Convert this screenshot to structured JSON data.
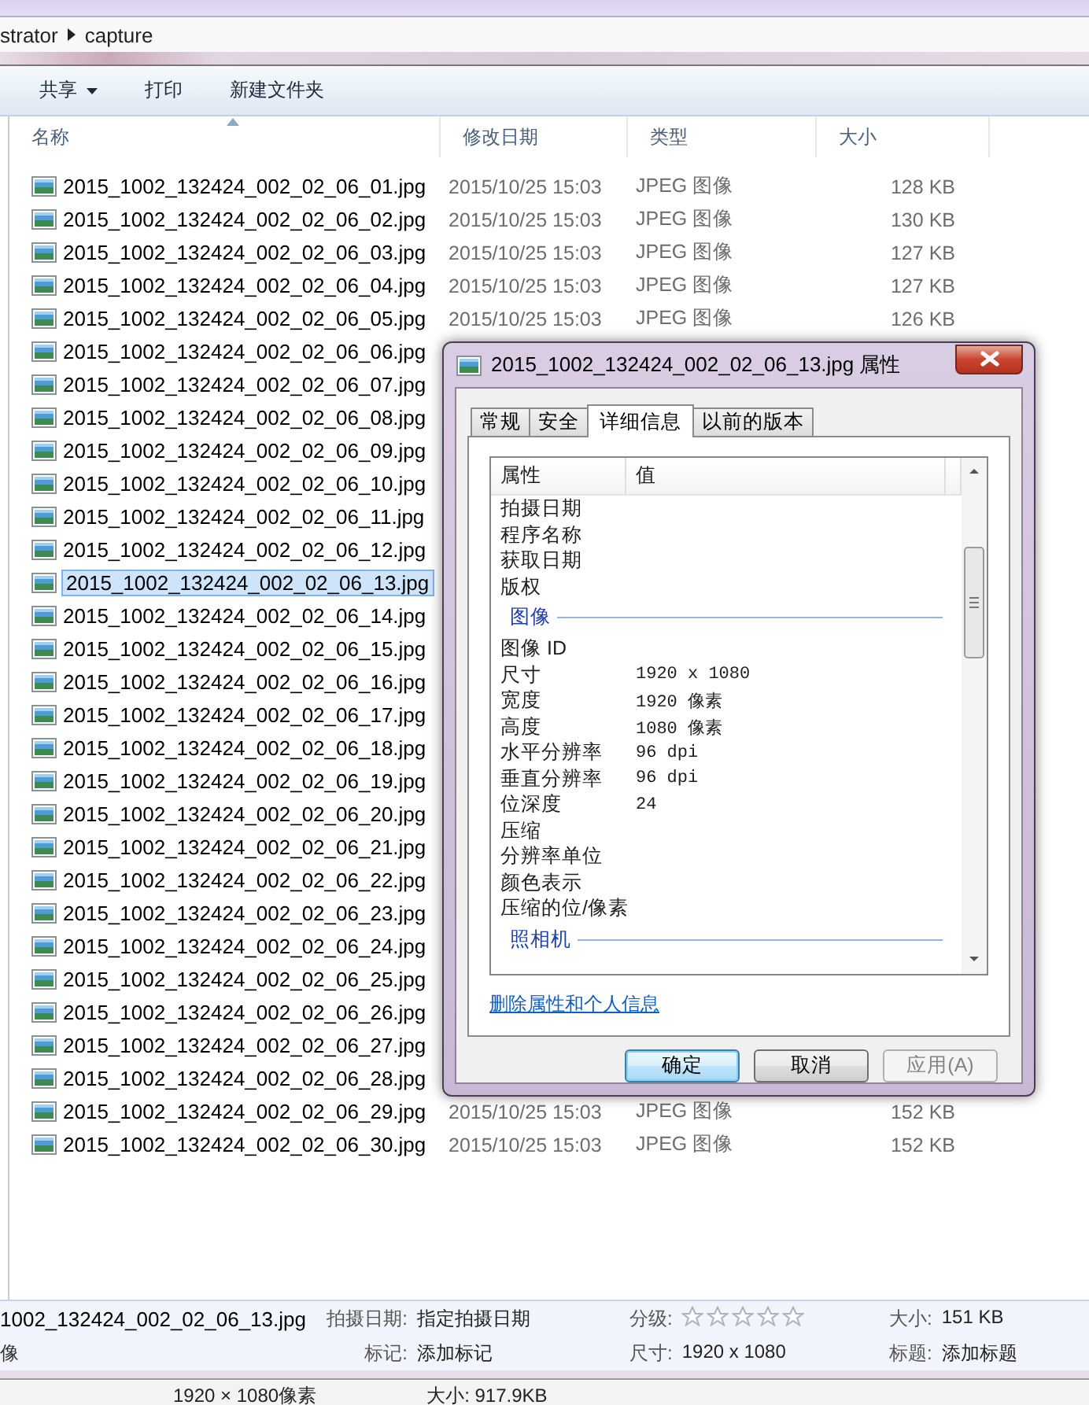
{
  "breadcrumb": {
    "items": [
      "strator",
      "capture"
    ]
  },
  "toolbar": {
    "buttons": [
      {
        "label": "共享",
        "dropdown": true
      },
      {
        "label": "打印",
        "dropdown": false
      },
      {
        "label": "新建文件夹",
        "dropdown": false
      }
    ]
  },
  "file_list": {
    "columns": [
      "名称",
      "修改日期",
      "类型",
      "大小"
    ],
    "rows": [
      {
        "name": "2015_1002_132424_002_02_06_01.jpg",
        "date": "2015/10/25 15:03",
        "type": "JPEG 图像",
        "size": "128 KB",
        "selected": false
      },
      {
        "name": "2015_1002_132424_002_02_06_02.jpg",
        "date": "2015/10/25 15:03",
        "type": "JPEG 图像",
        "size": "130 KB",
        "selected": false
      },
      {
        "name": "2015_1002_132424_002_02_06_03.jpg",
        "date": "2015/10/25 15:03",
        "type": "JPEG 图像",
        "size": "127 KB",
        "selected": false
      },
      {
        "name": "2015_1002_132424_002_02_06_04.jpg",
        "date": "2015/10/25 15:03",
        "type": "JPEG 图像",
        "size": "127 KB",
        "selected": false
      },
      {
        "name": "2015_1002_132424_002_02_06_05.jpg",
        "date": "2015/10/25 15:03",
        "type": "JPEG 图像",
        "size": "126 KB",
        "selected": false
      },
      {
        "name": "2015_1002_132424_002_02_06_06.jpg",
        "selected": false
      },
      {
        "name": "2015_1002_132424_002_02_06_07.jpg",
        "selected": false
      },
      {
        "name": "2015_1002_132424_002_02_06_08.jpg",
        "selected": false
      },
      {
        "name": "2015_1002_132424_002_02_06_09.jpg",
        "selected": false
      },
      {
        "name": "2015_1002_132424_002_02_06_10.jpg",
        "selected": false
      },
      {
        "name": "2015_1002_132424_002_02_06_11.jpg",
        "selected": false
      },
      {
        "name": "2015_1002_132424_002_02_06_12.jpg",
        "selected": false
      },
      {
        "name": "2015_1002_132424_002_02_06_13.jpg",
        "selected": true
      },
      {
        "name": "2015_1002_132424_002_02_06_14.jpg",
        "selected": false
      },
      {
        "name": "2015_1002_132424_002_02_06_15.jpg",
        "selected": false
      },
      {
        "name": "2015_1002_132424_002_02_06_16.jpg",
        "selected": false
      },
      {
        "name": "2015_1002_132424_002_02_06_17.jpg",
        "selected": false
      },
      {
        "name": "2015_1002_132424_002_02_06_18.jpg",
        "selected": false
      },
      {
        "name": "2015_1002_132424_002_02_06_19.jpg",
        "selected": false
      },
      {
        "name": "2015_1002_132424_002_02_06_20.jpg",
        "selected": false
      },
      {
        "name": "2015_1002_132424_002_02_06_21.jpg",
        "selected": false
      },
      {
        "name": "2015_1002_132424_002_02_06_22.jpg",
        "selected": false
      },
      {
        "name": "2015_1002_132424_002_02_06_23.jpg",
        "selected": false
      },
      {
        "name": "2015_1002_132424_002_02_06_24.jpg",
        "selected": false
      },
      {
        "name": "2015_1002_132424_002_02_06_25.jpg",
        "selected": false
      },
      {
        "name": "2015_1002_132424_002_02_06_26.jpg",
        "selected": false
      },
      {
        "name": "2015_1002_132424_002_02_06_27.jpg",
        "selected": false
      },
      {
        "name": "2015_1002_132424_002_02_06_28.jpg",
        "selected": false
      },
      {
        "name": "2015_1002_132424_002_02_06_29.jpg",
        "date": "2015/10/25 15:03",
        "type": "JPEG 图像",
        "size": "152 KB",
        "selected": false
      },
      {
        "name": "2015_1002_132424_002_02_06_30.jpg",
        "date": "2015/10/25 15:03",
        "type": "JPEG 图像",
        "size": "152 KB",
        "selected": false
      }
    ]
  },
  "details_pane": {
    "file_name": "1002_132424_002_02_06_13.jpg",
    "file_type": "像",
    "fields": [
      {
        "label": "拍摄日期:",
        "value": "指定拍摄日期"
      },
      {
        "label": "标记:",
        "value": "添加标记"
      },
      {
        "kind": "rating",
        "label": "分级:",
        "stars": 0
      },
      {
        "label": "尺寸:",
        "value": "1920 x 1080"
      },
      {
        "label": "大小:",
        "value": "151 KB"
      },
      {
        "label": "标题:",
        "value": "添加标题"
      }
    ]
  },
  "bottom_strip": [
    "1920 × 1080像素",
    "大小: 917.9KB"
  ],
  "dialog": {
    "title": "2015_1002_132424_002_02_06_13.jpg 属性",
    "tabs": [
      {
        "label": "常规",
        "selected": false
      },
      {
        "label": "安全",
        "selected": false
      },
      {
        "label": "详细信息",
        "selected": true
      },
      {
        "label": "以前的版本",
        "selected": false
      }
    ],
    "columns": [
      "属性",
      "值"
    ],
    "items": [
      {
        "kind": "property",
        "name": "拍摄日期"
      },
      {
        "kind": "property",
        "name": "程序名称"
      },
      {
        "kind": "property",
        "name": "获取日期"
      },
      {
        "kind": "property",
        "name": "版权"
      },
      {
        "kind": "section",
        "name": "图像"
      },
      {
        "kind": "property",
        "name": "图像 ID"
      },
      {
        "kind": "property",
        "name": "尺寸",
        "value": "1920 x 1080"
      },
      {
        "kind": "property",
        "name": "宽度",
        "value": "1920 像素"
      },
      {
        "kind": "property",
        "name": "高度",
        "value": "1080 像素"
      },
      {
        "kind": "property",
        "name": "水平分辨率",
        "value": "96 dpi"
      },
      {
        "kind": "property",
        "name": "垂直分辨率",
        "value": "96 dpi"
      },
      {
        "kind": "property",
        "name": "位深度",
        "value": "24"
      },
      {
        "kind": "property",
        "name": "压缩"
      },
      {
        "kind": "property",
        "name": "分辨率单位"
      },
      {
        "kind": "property",
        "name": "颜色表示"
      },
      {
        "kind": "property",
        "name": "压缩的位/像素"
      },
      {
        "kind": "section",
        "name": "照相机"
      }
    ],
    "link": "删除属性和个人信息",
    "buttons": [
      {
        "label": "确定",
        "kind": "default",
        "disabled": false
      },
      {
        "label": "取消",
        "kind": "normal",
        "disabled": false
      },
      {
        "label": "应用(A)",
        "kind": "normal",
        "disabled": true
      }
    ]
  }
}
